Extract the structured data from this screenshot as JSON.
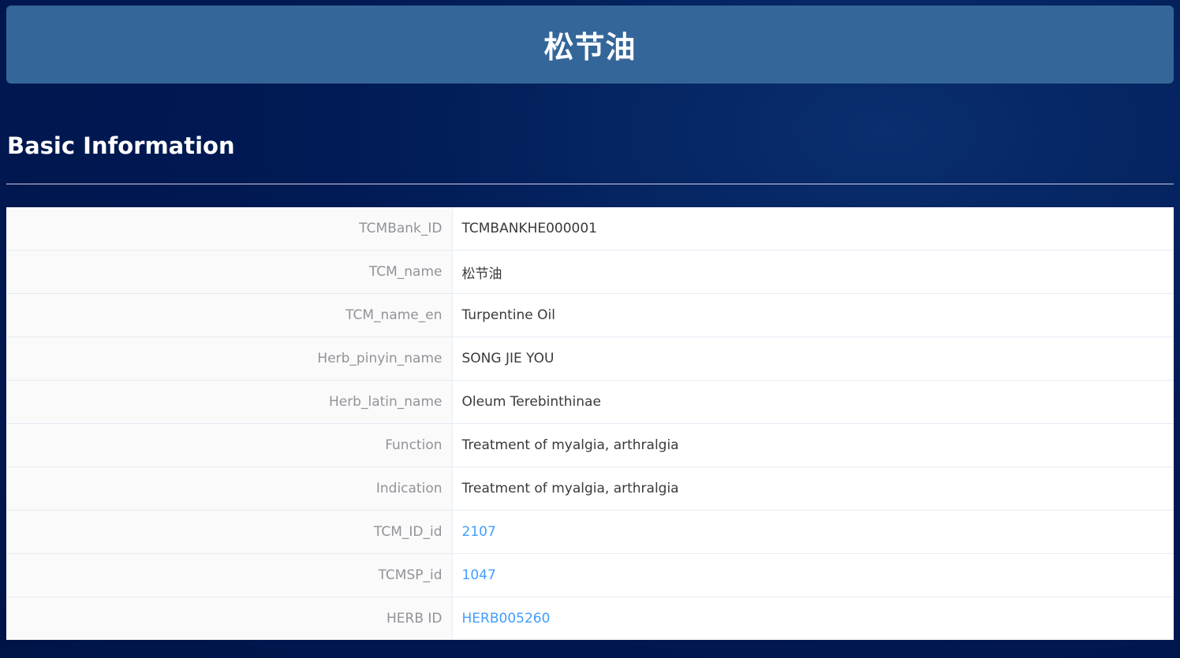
{
  "header": {
    "title": "松节油"
  },
  "section": {
    "title": "Basic Information"
  },
  "rows": [
    {
      "label": "TCMBank_ID",
      "value": "TCMBANKHE000001"
    },
    {
      "label": "TCM_name",
      "value": "松节油"
    },
    {
      "label": "TCM_name_en",
      "value": "Turpentine Oil"
    },
    {
      "label": "Herb_pinyin_name",
      "value": "SONG JIE YOU"
    },
    {
      "label": "Herb_latin_name",
      "value": "Oleum Terebinthinae"
    },
    {
      "label": "Function",
      "value": "Treatment of myalgia, arthralgia"
    },
    {
      "label": "Indication",
      "value": "Treatment of myalgia, arthralgia"
    },
    {
      "label": "TCM_ID_id",
      "value": "2107"
    },
    {
      "label": "TCMSP_id",
      "value": "1047"
    },
    {
      "label": "HERB ID",
      "value": "HERB005260"
    }
  ],
  "colors": {
    "header_bg": "#356699",
    "page_bg": "#001a55",
    "label_text": "#909399",
    "value_text": "#3a3a3a",
    "link": "#409eff"
  }
}
